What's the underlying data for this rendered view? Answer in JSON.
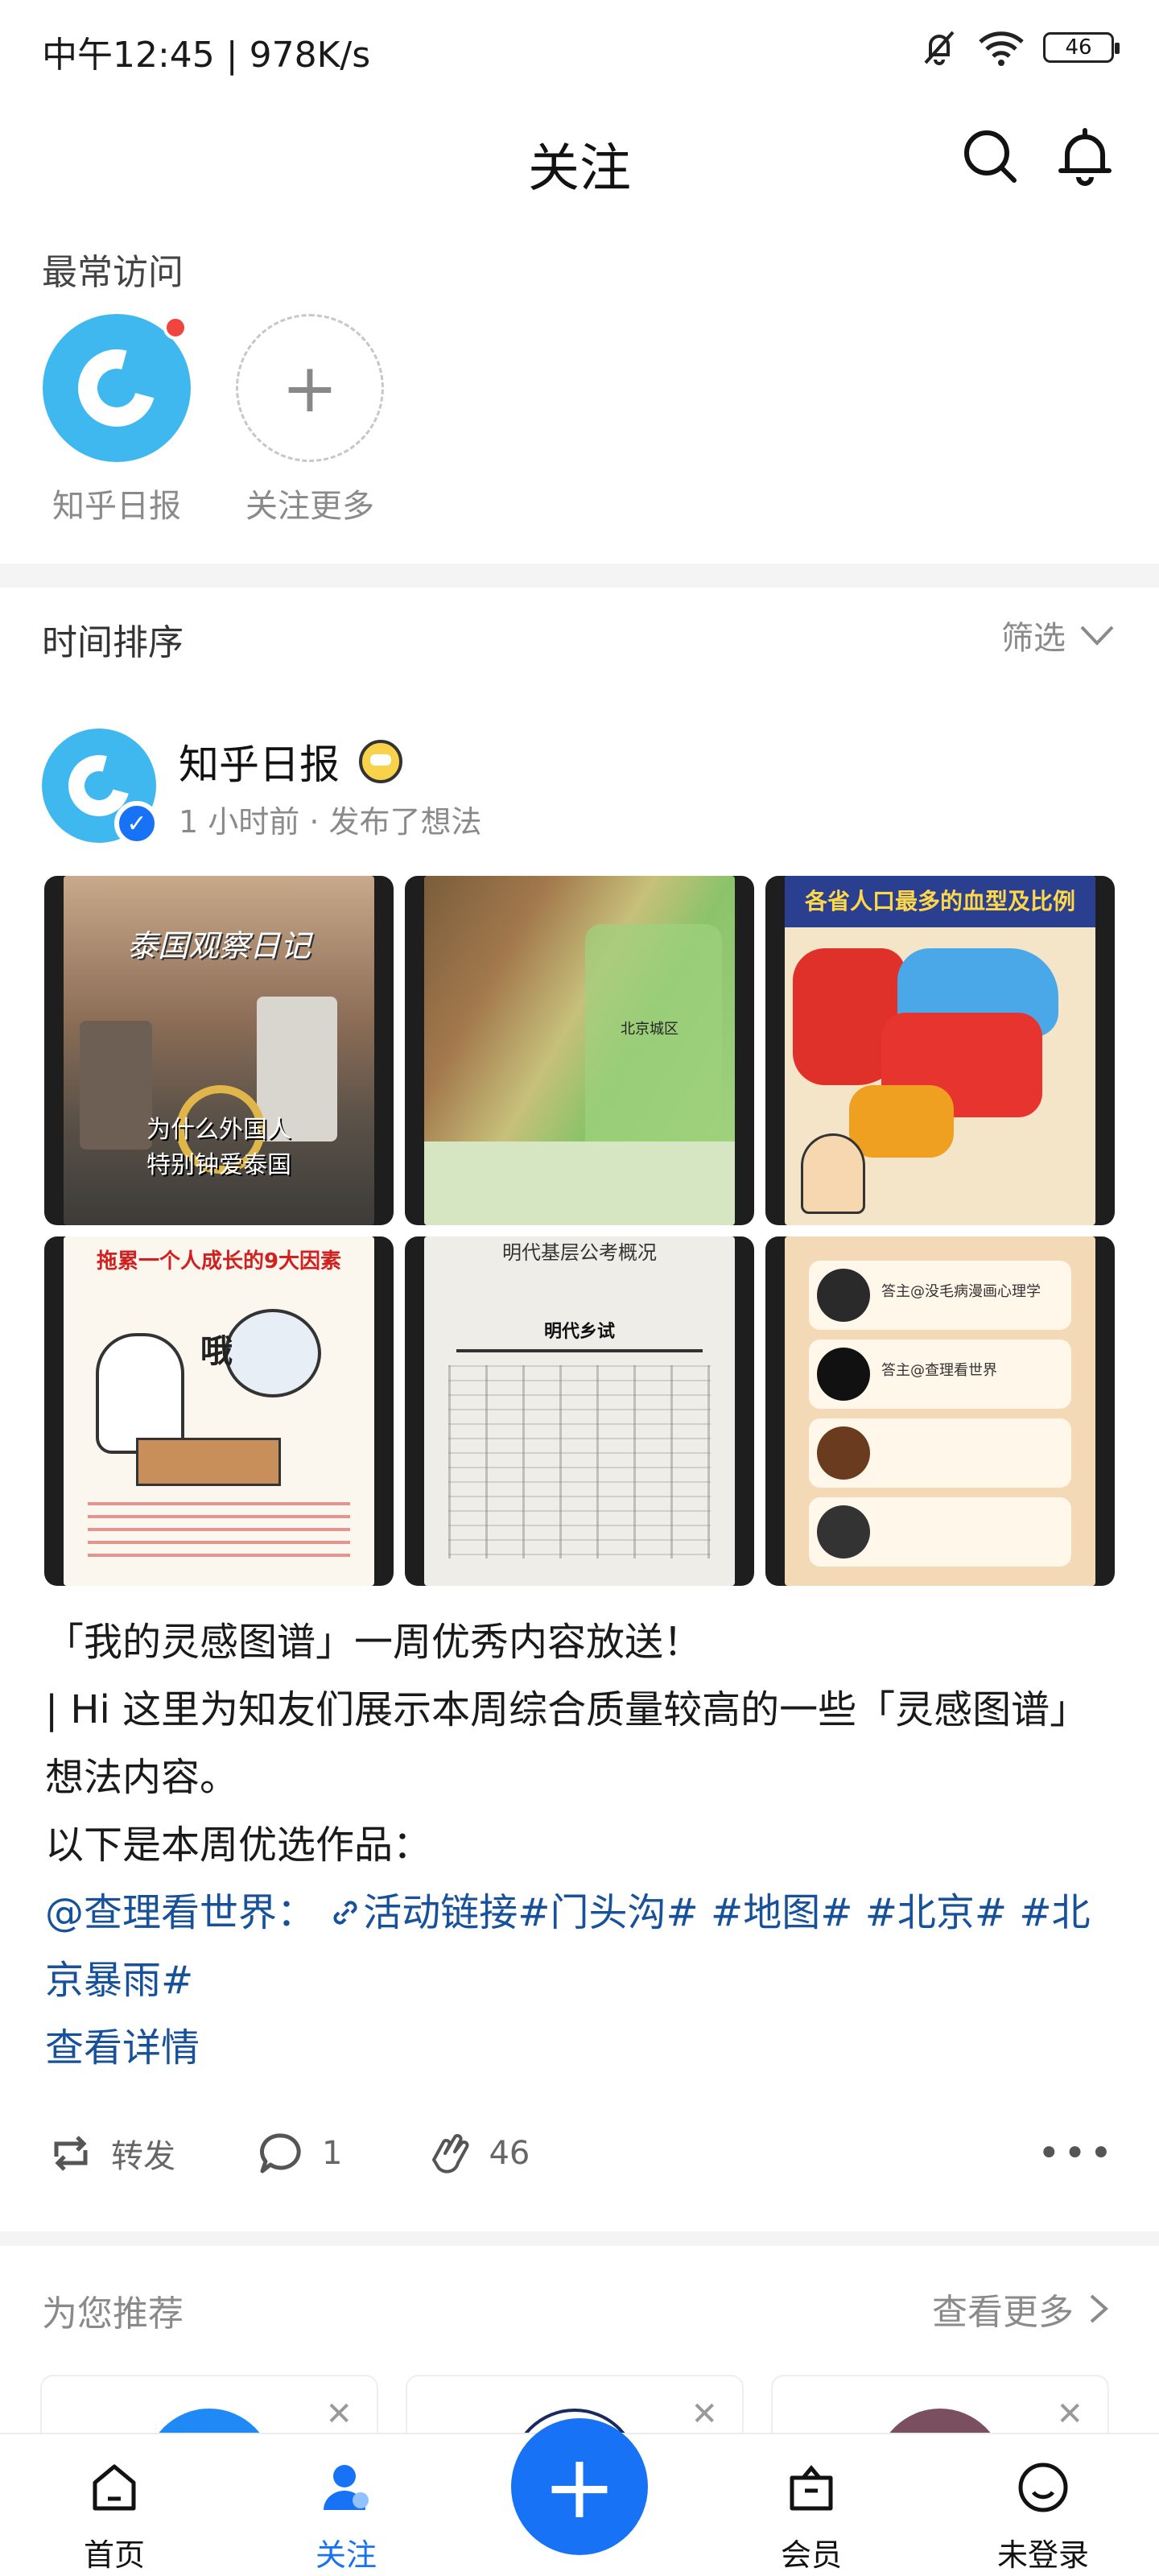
{
  "status_bar": {
    "time_speed": "中午12:45 | 978K/s",
    "battery": "46"
  },
  "header": {
    "title": "关注"
  },
  "frequent": {
    "title": "最常访问",
    "items": [
      {
        "label": "知乎日报"
      },
      {
        "label": "关注更多"
      }
    ]
  },
  "sort": {
    "title": "时间排序",
    "filter": "筛选"
  },
  "post": {
    "author": "知乎日报",
    "meta": "1 小时前 · 发布了想法",
    "images": [
      {
        "caption_top": "泰国观察日记",
        "caption_bottom": "为什么外国人\n特别钟爱泰国"
      },
      {
        "caption_top": "北京城区"
      },
      {
        "caption_top": "各省人口最多的血型及比例"
      },
      {
        "caption_top": "拖累一个人成长的9大因素",
        "caption_bottom": "哦"
      },
      {
        "caption_top": "明代基层公考概况",
        "caption_bottom": "明代乡试"
      },
      {
        "caption_top": "答主@没毛病漫画心理学",
        "caption_bottom": "答主@查理看世界"
      }
    ],
    "text_line1": "「我的灵感图谱」一周优秀内容放送！",
    "text_line2": "| Hi 这里为知友们展示本周综合质量较高的一些「灵感图谱」想法内容。",
    "text_line3": "以下是本周优选作品：",
    "mention": "@查理看世界",
    "colon": "：",
    "tags": "活动链接#门头沟# #地图# #北京# #北京暴雨#",
    "detail": "查看详情",
    "actions": {
      "repost": "转发",
      "comments": "1",
      "likes": "46"
    }
  },
  "recommend": {
    "title": "为您推荐",
    "more": "查看更多"
  },
  "bottom_nav": {
    "items": [
      {
        "label": "首页"
      },
      {
        "label": "关注"
      },
      {
        "label": "会员"
      },
      {
        "label": "未登录"
      }
    ]
  },
  "colors": {
    "accent": "#1772f6",
    "link": "#175199",
    "zhihu_blue": "#3fb8f0"
  }
}
